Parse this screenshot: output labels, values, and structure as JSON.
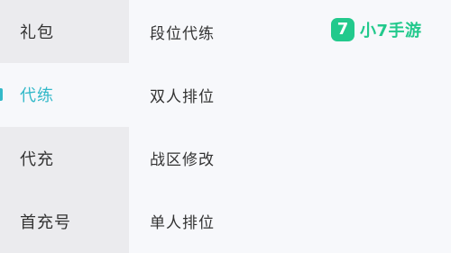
{
  "left_nav": {
    "items": [
      {
        "label": "礼包",
        "active": false
      },
      {
        "label": "代练",
        "active": true
      },
      {
        "label": "代充",
        "active": false
      },
      {
        "label": "首充号",
        "active": false
      }
    ]
  },
  "content": {
    "options": [
      {
        "label": "段位代练"
      },
      {
        "label": "双人排位"
      },
      {
        "label": "战区修改"
      },
      {
        "label": "单人排位"
      }
    ]
  },
  "brand": {
    "mark": "7",
    "name": "小7手游"
  },
  "colors": {
    "accent": "#33b9c9",
    "brand": "#22c98c",
    "nav_bg": "#ebebee",
    "content_bg": "#f7f8fb"
  }
}
